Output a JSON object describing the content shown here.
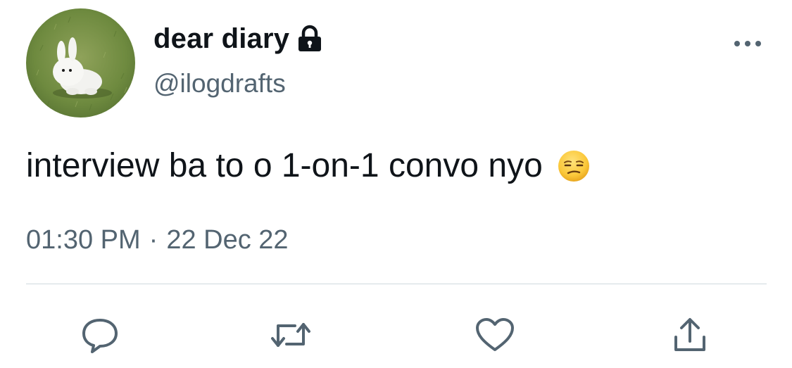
{
  "author": {
    "display_name": "dear diary",
    "handle": "@ilogdrafts",
    "avatar_icon": "bunny-on-grass-avatar",
    "protected_icon": "lock-icon"
  },
  "tweet": {
    "text": "interview ba to o 1-on-1 convo nyo",
    "emoji": "unamused-face-emoji",
    "time": "01:30 PM",
    "separator": "·",
    "date": "22 Dec 22"
  },
  "actions": [
    {
      "icon": "reply-icon"
    },
    {
      "icon": "retweet-icon"
    },
    {
      "icon": "like-icon"
    },
    {
      "icon": "share-icon"
    }
  ],
  "colors": {
    "text_primary": "#0f1419",
    "text_secondary": "#536471",
    "icon": "#536471",
    "divider": "#cfd9de"
  }
}
